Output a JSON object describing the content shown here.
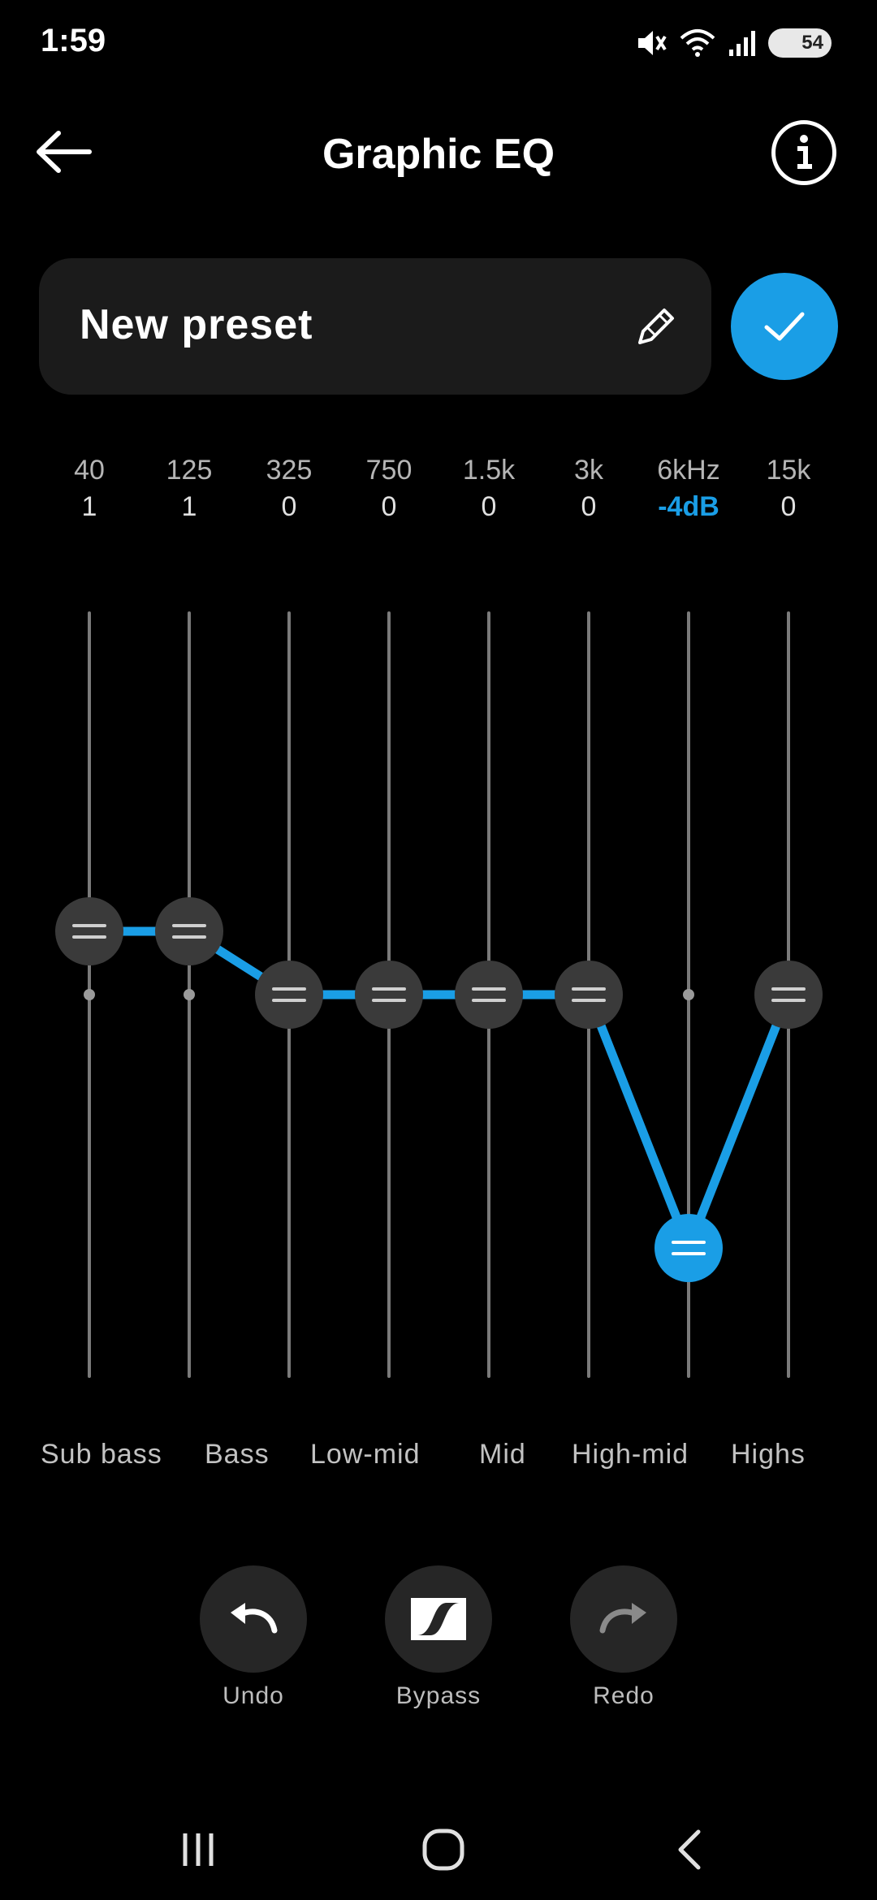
{
  "status_bar": {
    "time": "1:59",
    "battery": "54"
  },
  "header": {
    "title": "Graphic EQ"
  },
  "preset": {
    "name": "New preset"
  },
  "eq": {
    "bands": [
      {
        "freq": "40",
        "gain_label": "1",
        "gain_db": 1
      },
      {
        "freq": "125",
        "gain_label": "1",
        "gain_db": 1
      },
      {
        "freq": "325",
        "gain_label": "0",
        "gain_db": 0
      },
      {
        "freq": "750",
        "gain_label": "0",
        "gain_db": 0
      },
      {
        "freq": "1.5k",
        "gain_label": "0",
        "gain_db": 0
      },
      {
        "freq": "3k",
        "gain_label": "0",
        "gain_db": 0
      },
      {
        "freq": "6kHz",
        "gain_label": "-4dB",
        "gain_db": -4
      },
      {
        "freq": "15k",
        "gain_label": "0",
        "gain_db": 0
      }
    ],
    "selected_band": 6,
    "ranges": [
      "Sub bass",
      "Bass",
      "Low-mid",
      "Mid",
      "High-mid",
      "Highs"
    ]
  },
  "controls": {
    "undo": "Undo",
    "bypass": "Bypass",
    "redo": "Redo"
  },
  "colors": {
    "accent": "#1a9ee6",
    "background": "#000000",
    "knob": "#3a3a3a",
    "track": "#7a7a7a"
  },
  "icons": {
    "back": "arrow-left-icon",
    "info": "info-icon",
    "edit": "pencil-icon",
    "confirm": "check-icon",
    "undo": "undo-icon",
    "bypass": "bypass-icon",
    "redo": "redo-icon",
    "nav_recent": "recent-apps-icon",
    "nav_home": "home-icon",
    "nav_back": "nav-back-icon"
  }
}
